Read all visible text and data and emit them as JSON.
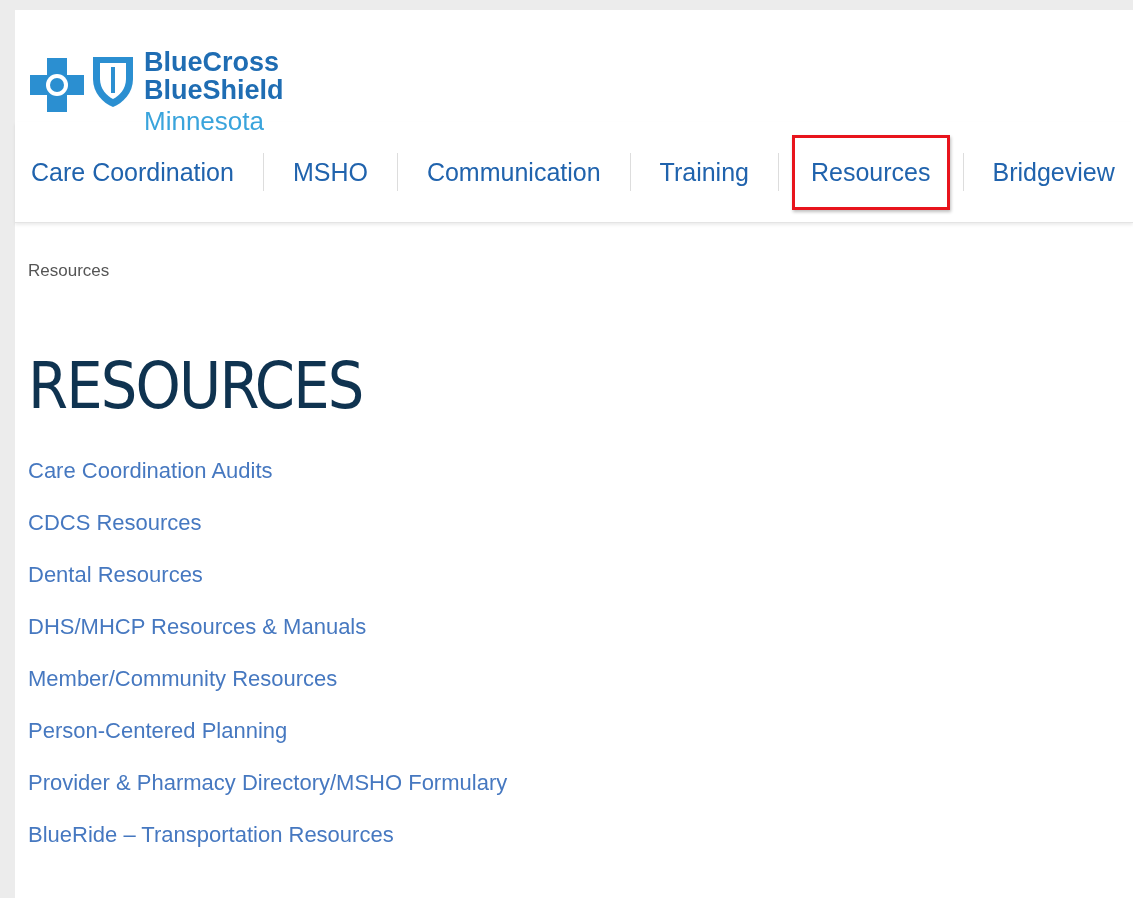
{
  "logo": {
    "line_1": "BlueCross",
    "line_2": "BlueShield",
    "line_3": "Minnesota"
  },
  "nav": [
    {
      "label": "Care Coordination",
      "highlighted": false
    },
    {
      "label": "MSHO",
      "highlighted": false
    },
    {
      "label": "Communication",
      "highlighted": false
    },
    {
      "label": "Training",
      "highlighted": false
    },
    {
      "label": "Resources",
      "highlighted": true
    },
    {
      "label": "Bridgeview",
      "highlighted": false
    }
  ],
  "breadcrumb": "Resources",
  "heading": "RESOURCES",
  "links": [
    "Care Coordination Audits",
    "CDCS Resources",
    "Dental Resources",
    "DHS/MHCP Resources & Manuals",
    "Member/Community Resources",
    "Person-Centered Planning",
    "Provider & Pharmacy Directory/MSHO Formulary",
    "BlueRide – Transportation Resources"
  ]
}
